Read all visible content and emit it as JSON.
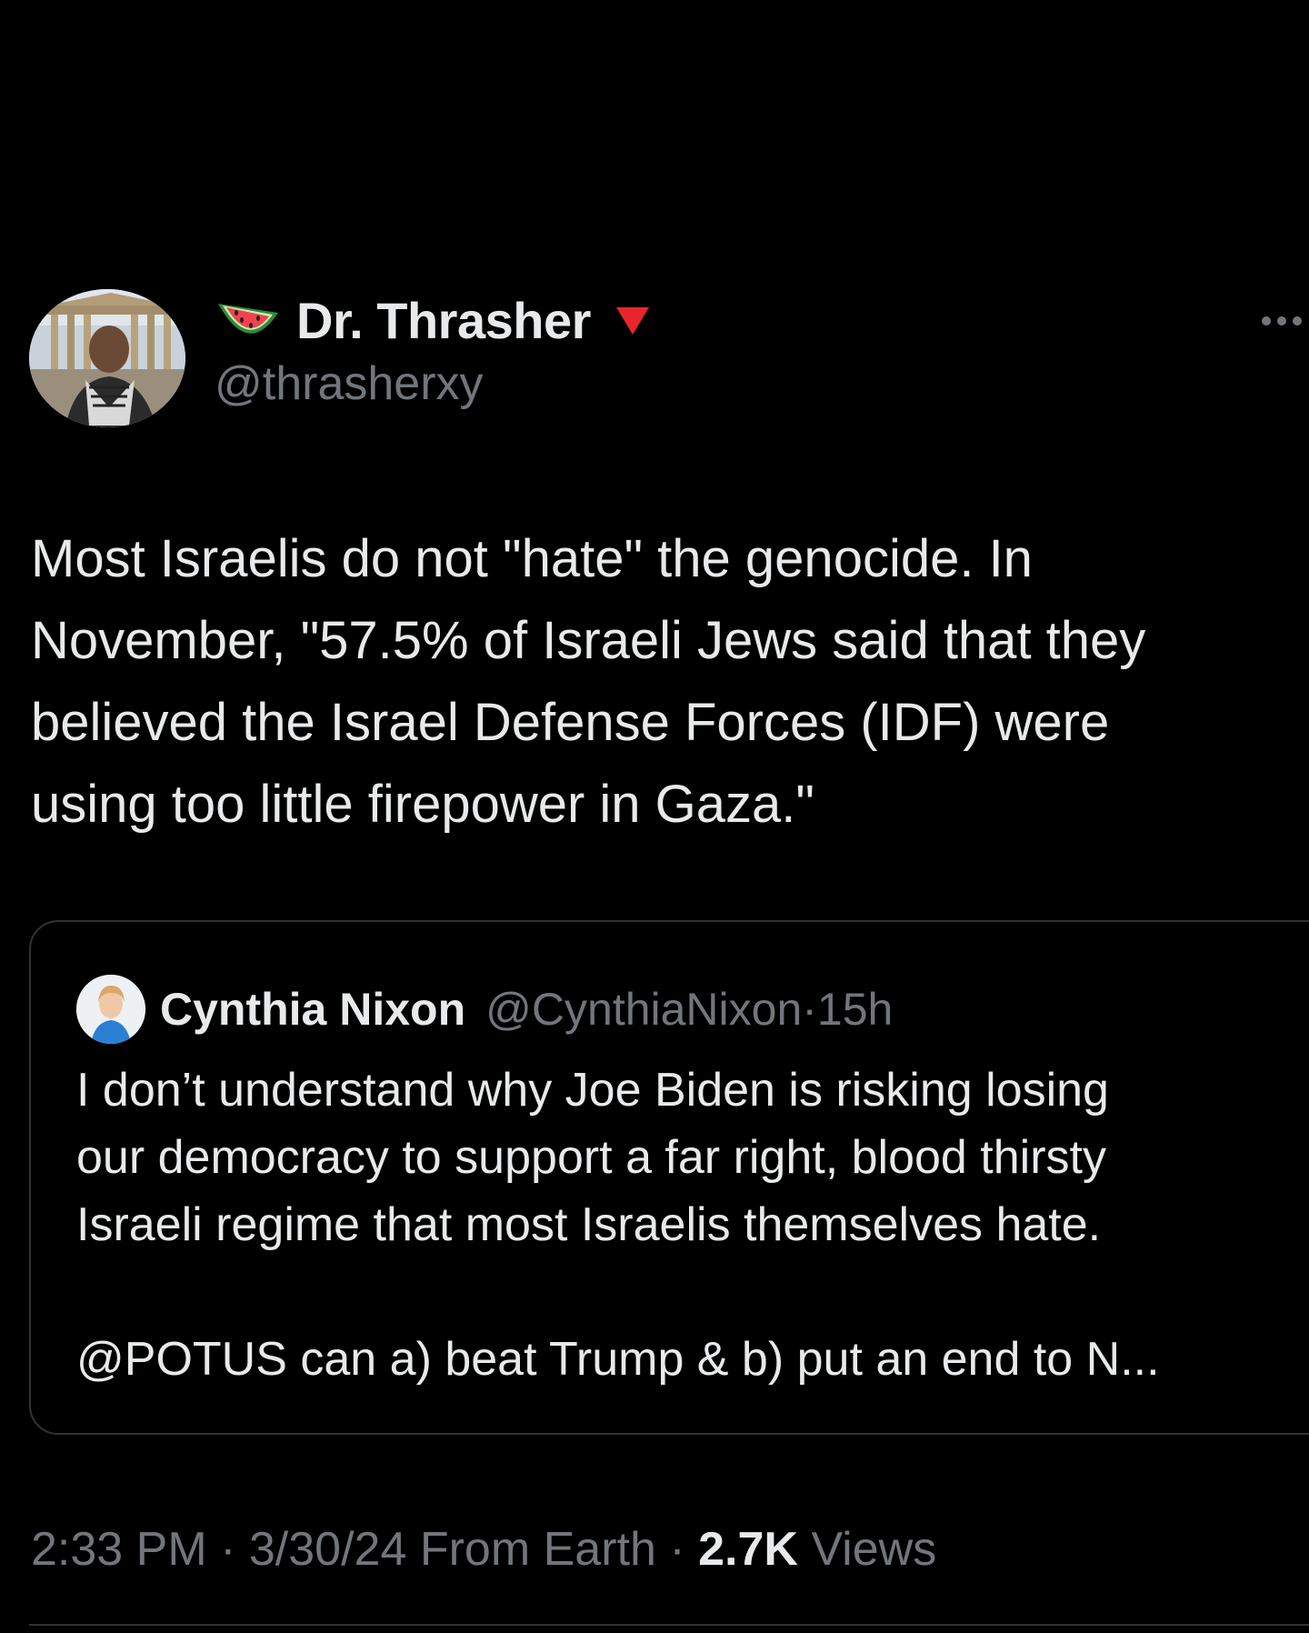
{
  "tweet": {
    "author": {
      "display_name": "Dr. Thrasher",
      "handle": "@thrasherxy",
      "name_prefix_icon": "watermelon-icon",
      "name_suffix_icon": "red-triangle-icon"
    },
    "text_lines": [
      "Most Israelis do not \"hate\" the genocide. In",
      "November, \"57.5% of Israeli Jews said that they",
      "believed the Israel Defense Forces (IDF) were",
      "using too little firepower in Gaza.\""
    ],
    "quote": {
      "display_name": "Cynthia Nixon",
      "handle": "@CynthiaNixon",
      "separator": "·",
      "time": "15h",
      "text_lines": [
        "I don’t understand why Joe Biden is risking losing",
        "our democracy to support a far right, blood thirsty",
        "Israeli regime that most Israelis themselves hate."
      ],
      "text_line_2": "@POTUS can a) beat Trump & b) put an end to N..."
    },
    "meta": {
      "time": "2:33 PM",
      "date": "3/30/24",
      "location": "From Earth",
      "separator": "·",
      "views_count": "2.7K",
      "views_label": "Views"
    }
  },
  "colors": {
    "background": "#000000",
    "text_primary": "#e7e9ea",
    "text_secondary": "#71767b",
    "border": "#2f3336"
  }
}
